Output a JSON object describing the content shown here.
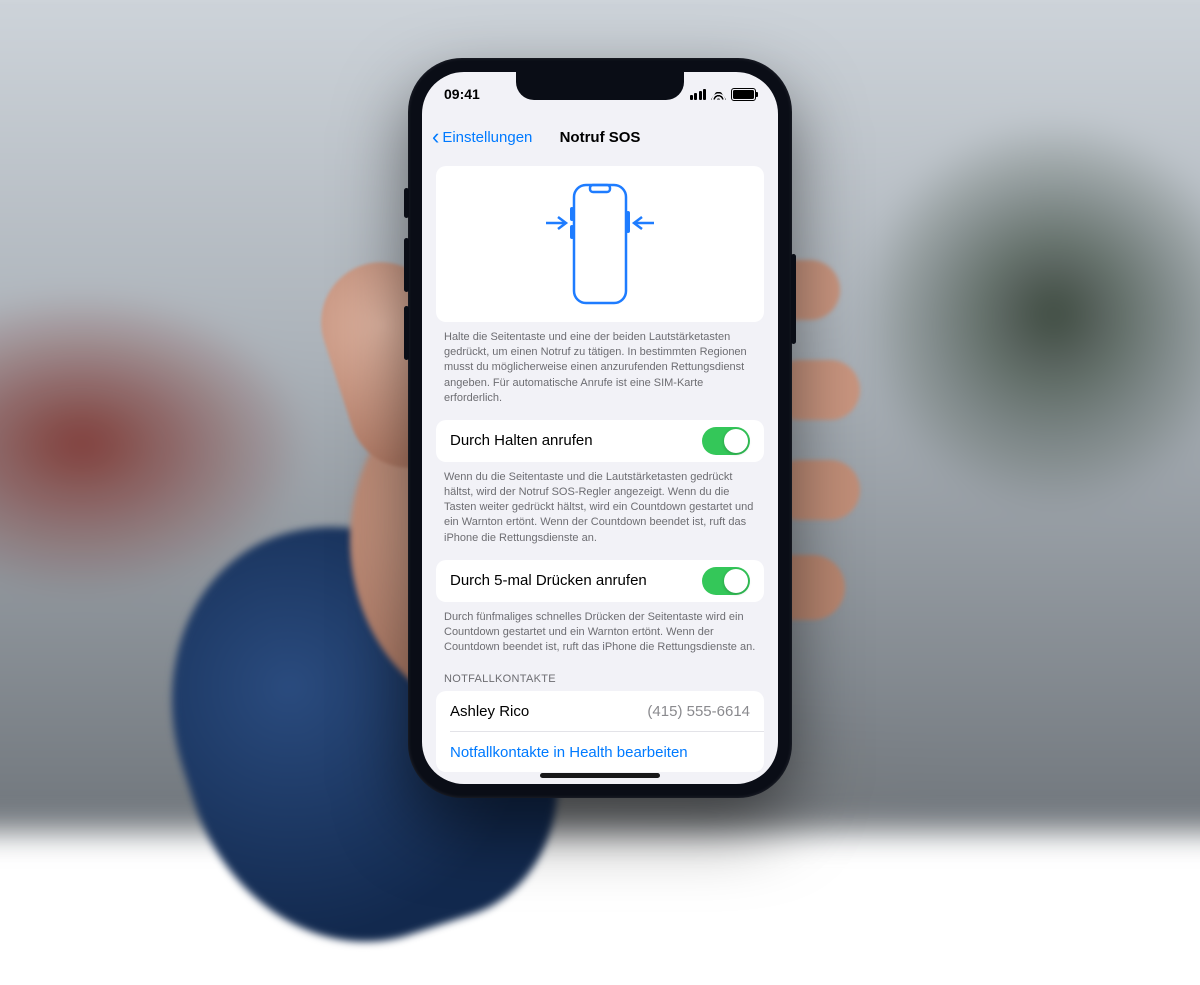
{
  "status": {
    "time": "09:41"
  },
  "nav": {
    "back": "Einstellungen",
    "title": "Notruf SOS"
  },
  "hero_footer": "Halte die Seitentaste und eine der beiden Lautstärketasten gedrückt, um einen Notruf zu tätigen. In bestimmten Regionen musst du möglicherweise einen anzurufenden Rettungsdienst angeben. Für automatische Anrufe ist eine SIM-Karte erforderlich.",
  "row1": {
    "label": "Durch Halten anrufen"
  },
  "row1_footer": "Wenn du die Seitentaste und die Lautstärketasten gedrückt hältst, wird der Notruf SOS-Regler angezeigt. Wenn du die Tasten weiter gedrückt hältst, wird ein Countdown gestartet und ein Warnton ertönt. Wenn der Countdown beendet ist, ruft das iPhone die Rettungsdienste an.",
  "row2": {
    "label": "Durch 5-mal Drücken anrufen"
  },
  "row2_footer": "Durch fünfmaliges schnelles Drücken der Seitentaste wird ein Countdown gestartet und ein Warnton ertönt. Wenn der Countdown beendet ist, ruft das iPhone die Rettungsdienste an.",
  "contacts": {
    "header": "NOTFALLKONTAKTE",
    "name": "Ashley Rico",
    "phone": "(415) 555-6614",
    "edit": "Notfallkontakte in Health bearbeiten"
  }
}
